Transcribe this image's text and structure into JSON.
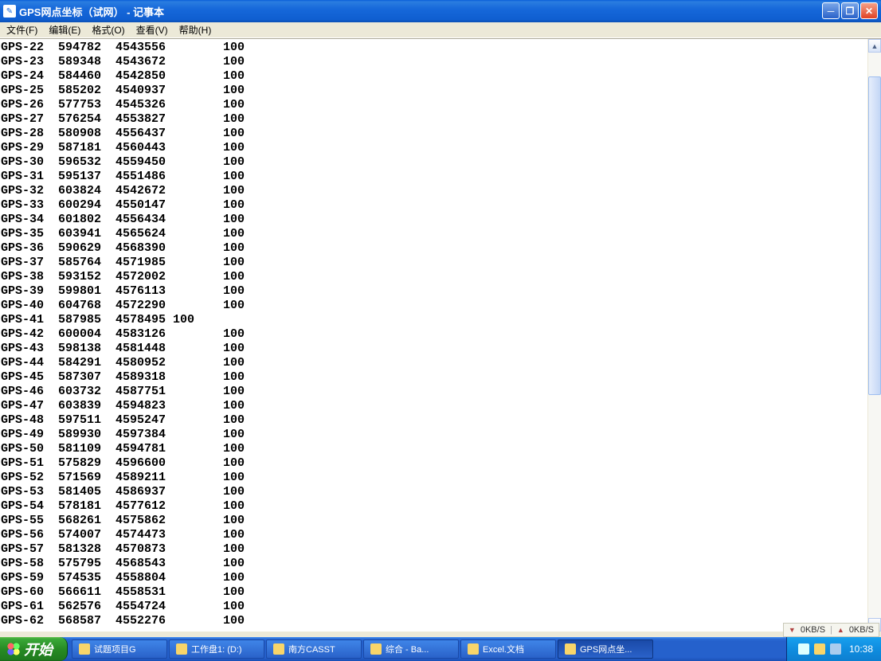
{
  "window": {
    "title": "GPS网点坐标（试网） - 记事本"
  },
  "menu": {
    "file": "文件(F)",
    "edit": "编辑(E)",
    "format": "格式(O)",
    "view": "查看(V)",
    "help": "帮助(H)"
  },
  "rows": [
    {
      "id": "GPS-22",
      "x": "594782",
      "y": "4543556",
      "h": "100"
    },
    {
      "id": "GPS-23",
      "x": "589348",
      "y": "4543672",
      "h": "100"
    },
    {
      "id": "GPS-24",
      "x": "584460",
      "y": "4542850",
      "h": "100"
    },
    {
      "id": "GPS-25",
      "x": "585202",
      "y": "4540937",
      "h": "100"
    },
    {
      "id": "GPS-26",
      "x": "577753",
      "y": "4545326",
      "h": "100"
    },
    {
      "id": "GPS-27",
      "x": "576254",
      "y": "4553827",
      "h": "100"
    },
    {
      "id": "GPS-28",
      "x": "580908",
      "y": "4556437",
      "h": "100"
    },
    {
      "id": "GPS-29",
      "x": "587181",
      "y": "4560443",
      "h": "100"
    },
    {
      "id": "GPS-30",
      "x": "596532",
      "y": "4559450",
      "h": "100"
    },
    {
      "id": "GPS-31",
      "x": "595137",
      "y": "4551486",
      "h": "100"
    },
    {
      "id": "GPS-32",
      "x": "603824",
      "y": "4542672",
      "h": "100"
    },
    {
      "id": "GPS-33",
      "x": "600294",
      "y": "4550147",
      "h": "100"
    },
    {
      "id": "GPS-34",
      "x": "601802",
      "y": "4556434",
      "h": "100"
    },
    {
      "id": "GPS-35",
      "x": "603941",
      "y": "4565624",
      "h": "100"
    },
    {
      "id": "GPS-36",
      "x": "590629",
      "y": "4568390",
      "h": "100"
    },
    {
      "id": "GPS-37",
      "x": "585764",
      "y": "4571985",
      "h": "100"
    },
    {
      "id": "GPS-38",
      "x": "593152",
      "y": "4572002",
      "h": "100"
    },
    {
      "id": "GPS-39",
      "x": "599801",
      "y": "4576113",
      "h": "100"
    },
    {
      "id": "GPS-40",
      "x": "604768",
      "y": "4572290",
      "h": "100"
    },
    {
      "id": "GPS-41",
      "x": "587985",
      "y": "4578495",
      "h": "100",
      "short": true
    },
    {
      "id": "GPS-42",
      "x": "600004",
      "y": "4583126",
      "h": "100"
    },
    {
      "id": "GPS-43",
      "x": "598138",
      "y": "4581448",
      "h": "100"
    },
    {
      "id": "GPS-44",
      "x": "584291",
      "y": "4580952",
      "h": "100"
    },
    {
      "id": "GPS-45",
      "x": "587307",
      "y": "4589318",
      "h": "100"
    },
    {
      "id": "GPS-46",
      "x": "603732",
      "y": "4587751",
      "h": "100"
    },
    {
      "id": "GPS-47",
      "x": "603839",
      "y": "4594823",
      "h": "100"
    },
    {
      "id": "GPS-48",
      "x": "597511",
      "y": "4595247",
      "h": "100"
    },
    {
      "id": "GPS-49",
      "x": "589930",
      "y": "4597384",
      "h": "100"
    },
    {
      "id": "GPS-50",
      "x": "581109",
      "y": "4594781",
      "h": "100"
    },
    {
      "id": "GPS-51",
      "x": "575829",
      "y": "4596600",
      "h": "100"
    },
    {
      "id": "GPS-52",
      "x": "571569",
      "y": "4589211",
      "h": "100"
    },
    {
      "id": "GPS-53",
      "x": "581405",
      "y": "4586937",
      "h": "100"
    },
    {
      "id": "GPS-54",
      "x": "578181",
      "y": "4577612",
      "h": "100"
    },
    {
      "id": "GPS-55",
      "x": "568261",
      "y": "4575862",
      "h": "100"
    },
    {
      "id": "GPS-56",
      "x": "574007",
      "y": "4574473",
      "h": "100"
    },
    {
      "id": "GPS-57",
      "x": "581328",
      "y": "4570873",
      "h": "100"
    },
    {
      "id": "GPS-58",
      "x": "575795",
      "y": "4568543",
      "h": "100"
    },
    {
      "id": "GPS-59",
      "x": "574535",
      "y": "4558804",
      "h": "100"
    },
    {
      "id": "GPS-60",
      "x": "566611",
      "y": "4558531",
      "h": "100"
    },
    {
      "id": "GPS-61",
      "x": "562576",
      "y": "4554724",
      "h": "100"
    },
    {
      "id": "GPS-62",
      "x": "568587",
      "y": "4552276",
      "h": "100"
    }
  ],
  "status": {
    "left": "0KB/S",
    "right": "0KB/S"
  },
  "taskbar": {
    "start": "开始",
    "items": [
      {
        "label": "试题项目G"
      },
      {
        "label": "工作盘1: (D:)"
      },
      {
        "label": "南方CASST"
      },
      {
        "label": "综合 - Ba..."
      },
      {
        "label": "Excel.文档"
      },
      {
        "label": "GPS网点坐...",
        "active": true
      }
    ],
    "clock": "10:38"
  }
}
